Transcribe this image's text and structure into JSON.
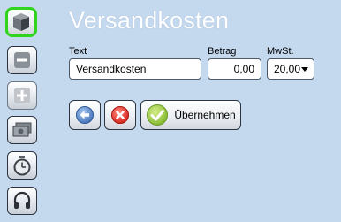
{
  "title": "Versandkosten",
  "sidebar": {
    "items": [
      {
        "icon": "box-icon",
        "state": "active"
      },
      {
        "icon": "minus-icon",
        "state": "enabled"
      },
      {
        "icon": "plus-icon",
        "state": "disabled"
      },
      {
        "icon": "cash-icon",
        "state": "enabled"
      },
      {
        "icon": "timer-icon",
        "state": "enabled"
      },
      {
        "icon": "headset-icon",
        "state": "enabled"
      }
    ]
  },
  "form": {
    "text_label": "Text",
    "text_value": "Versandkosten",
    "amount_label": "Betrag",
    "amount_value": "0,00",
    "vat_label": "MwSt.",
    "vat_value": "20,00"
  },
  "actions": {
    "back_icon": "arrow-left-icon",
    "cancel_icon": "close-icon",
    "apply_icon": "checkmark-icon",
    "apply_label": "Übernehmen"
  },
  "colors": {
    "background": "#c4d8ee",
    "active_highlight": "#2fd41d",
    "title": "#ffffff"
  }
}
